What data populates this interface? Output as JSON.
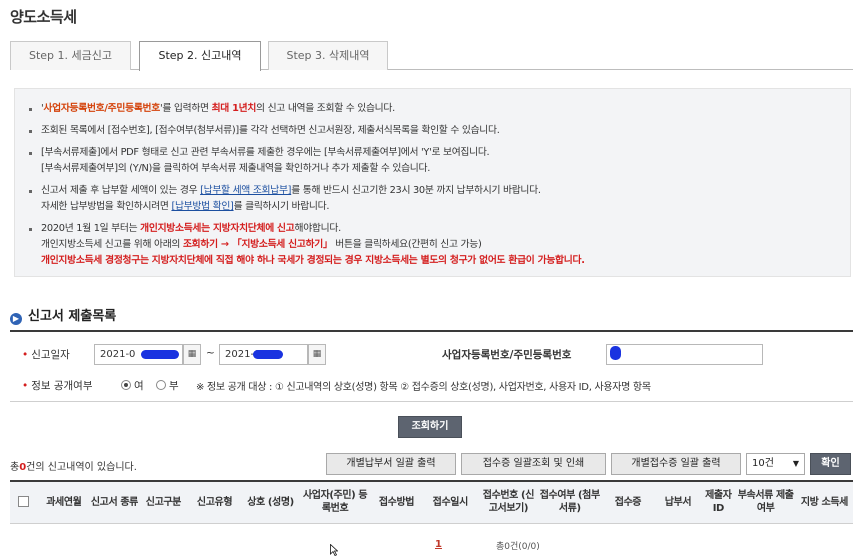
{
  "page": {
    "title": "양도소득세"
  },
  "tabs": [
    {
      "label": "Step 1. 세금신고"
    },
    {
      "label": "Step 2. 신고내역"
    },
    {
      "label": "Step 3. 삭제내역"
    }
  ],
  "notice": {
    "l1_a": "'",
    "l1_b": "사업자등록번호/주민등록번호",
    "l1_c": "'를 입력하면 ",
    "l1_d": "최대 1년치",
    "l1_e": "의 신고 내역을 조회할 수 있습니다.",
    "l2": "조회된 목록에서 [접수번호], [접수여부(첨부서류)]를 각각 선택하면 신고서원장, 제출서식목록을 확인할 수 있습니다.",
    "l3a": "[부속서류제출]에서 PDF 형태로 신고 관련 부속서류를 제출한 경우에는 [부속서류제출여부]에서 'Y'로 보여집니다.",
    "l3b": "[부속서류제출여부]의 (Y/N)을 클릭하여 부속서류 제출내역을 확인하거나 추가 제출할 수 있습니다.",
    "l4_a": "신고서 제출 후 납부할 세액이 있는 경우 ",
    "l4_link": "[납부할 세액 조회납부]",
    "l4_b": "를 통해 반드시 신고기한 23시 30분 까지 납부하시기 바랍니다.",
    "l4b_a": "자세한 납부방법을 확인하시려면 ",
    "l4b_link": "[납부방법 확인]",
    "l4b_b": "를 클릭하시기 바랍니다.",
    "l5_a": "2020년 1월 1일 부터는 ",
    "l5_b": "개인지방소득세는 지방자치단체에 신고",
    "l5_c": "해야합니다.",
    "l5b_a": "개인지방소득세 신고를 위해 아래의 ",
    "l5b_b": "조회하기 → 「지방소득세 신고하기」",
    "l5b_c": " 버튼을 클릭하세요(간편히 신고 가능)",
    "l5c": "개인지방소득세 경정청구는 지방자치단체에 직접 해야 하나 국세가 경정되는 경우 지방소득세는 별도의 청구가 없어도 환급이 가능합니다."
  },
  "section": {
    "title": "신고서 제출목록"
  },
  "search": {
    "date_label": "신고일자",
    "date_from": "2021-0",
    "date_sep": "~",
    "date_to": "2021-0",
    "id_label": "사업자등록번호/주민등록번호",
    "id_value": "",
    "public_label": "정보 공개여부",
    "radio_yes": "여",
    "radio_no": "부",
    "public_note": "※ 정보 공개 대상 : ① 신고내역의 상호(성명) 항목 ② 접수증의 상호(성명), 사업자번호, 사용자 ID, 사용자명 항목",
    "search_button": "조회하기"
  },
  "list": {
    "count_prefix": "총",
    "count_value": "0",
    "count_suffix": "건의 신고내역이 있습니다.",
    "btn_bulk_pay": "개별납부서 일괄 출력",
    "btn_bulk_receipt": "접수증 일괄조회 및 인쇄",
    "btn_bulk_individual": "개별접수증 일괄 출력",
    "page_size": "10건",
    "confirm_button": "확인",
    "columns": [
      "과세연월",
      "신고서 종류",
      "신고구분",
      "신고유형",
      "상호 (성명)",
      "사업자(주민) 등록번호",
      "접수방법",
      "접수일시",
      "접수번호 (신고서보기)",
      "접수여부 (첨부서류)",
      "접수증",
      "납부서",
      "제출자 ID",
      "부속서류 제출여부",
      "지방 소득세"
    ],
    "page_number": "1",
    "page_info": "총0건(0/0)"
  },
  "colors": {
    "accent": "#2f63b5",
    "warning": "#d41e1e",
    "highlight": "#d4420a",
    "mask": "#1a33e0"
  }
}
